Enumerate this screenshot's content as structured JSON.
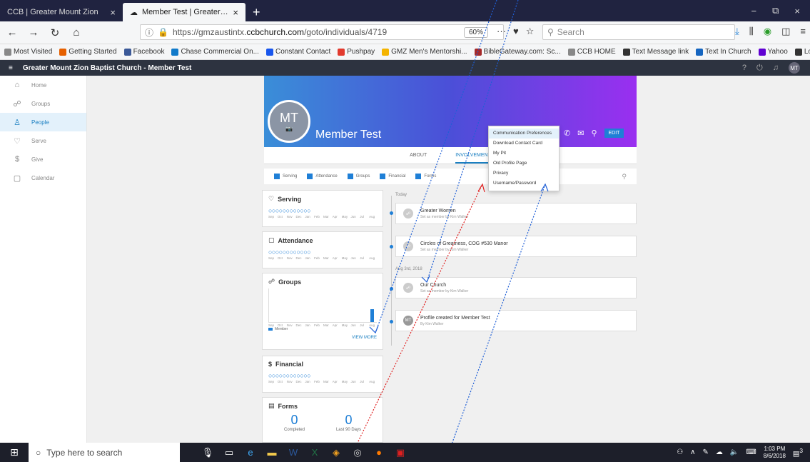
{
  "browser": {
    "tabs": [
      {
        "label": "CCB | Greater Mount Zion",
        "close": "×"
      },
      {
        "label": "Member Test | Greater Mount Z",
        "close": "×"
      }
    ],
    "new_tab": "+",
    "window_controls": [
      "−",
      "⧉",
      "×"
    ],
    "url_secure": "https://gmzaustintx.",
    "url_domain": "ccbchurch.com",
    "url_path": "/goto/individuals/4719",
    "zoom": "60%",
    "search_placeholder": "Search",
    "bookmarks": [
      {
        "label": "Most Visited",
        "color": "#888888"
      },
      {
        "label": "Getting Started",
        "color": "#e66000"
      },
      {
        "label": "Facebook",
        "color": "#3b5998"
      },
      {
        "label": "Chase Commercial On...",
        "color": "#117aca"
      },
      {
        "label": "Constant Contact",
        "color": "#1856ed"
      },
      {
        "label": "Pushpay",
        "color": "#e23b2e"
      },
      {
        "label": "GMZ Men's Mentorshi...",
        "color": "#f4b400"
      },
      {
        "label": "BibleGateway.com: Sc...",
        "color": "#a52a2a"
      },
      {
        "label": "CCB HOME",
        "color": "#888888"
      },
      {
        "label": "Text Message link",
        "color": "#333333"
      },
      {
        "label": "Text In Church",
        "color": "#1565c0"
      },
      {
        "label": "Yahoo",
        "color": "#6001d2"
      },
      {
        "label": "Login",
        "color": "#333333"
      }
    ]
  },
  "app": {
    "title": "Greater Mount Zion Baptist Church - Member Test",
    "avatar": "MT"
  },
  "sidebar": {
    "items": [
      {
        "label": "Home",
        "icon": "⌂"
      },
      {
        "label": "Groups",
        "icon": "☍"
      },
      {
        "label": "People",
        "icon": "♙"
      },
      {
        "label": "Serve",
        "icon": "♡"
      },
      {
        "label": "Give",
        "icon": "$"
      },
      {
        "label": "Calendar",
        "icon": "▢"
      }
    ]
  },
  "profile": {
    "initials": "MT",
    "name": "Member Test",
    "edit": "EDIT"
  },
  "tabs": [
    "ABOUT",
    "INVOLVEMENT"
  ],
  "filters": [
    "Serving",
    "Attendance",
    "Groups",
    "Financial",
    "Forms"
  ],
  "dropdown": [
    "Communication Preferences",
    "Download Contact Card",
    "My Pit",
    "Old Profile Page",
    "Privacy",
    "Username/Password"
  ],
  "cards": {
    "serving": "Serving",
    "attendance": "Attendance",
    "groups": "Groups",
    "groups_legend": "Member",
    "view_more": "VIEW MORE",
    "financial": "Financial",
    "forms": "Forms",
    "forms_completed_count": "0",
    "forms_completed_label": "Completed",
    "forms_last_count": "0",
    "forms_last_label": "Last 90 Days",
    "months": [
      "Sep",
      "Oct",
      "Nov",
      "Dec",
      "Jan",
      "Feb",
      "Mar",
      "Apr",
      "May",
      "Jun",
      "Jul",
      "Aug"
    ]
  },
  "timeline": {
    "today": "Today",
    "date2": "Aug 3rd, 2018",
    "items": [
      {
        "title": "Greater Women",
        "sub": "Set as member by Kim Walker"
      },
      {
        "title": "Circles of Greatness, COG #530 Manor",
        "sub": "Set as member by Kim Walker"
      },
      {
        "title": "Our Church",
        "sub": "Set as member by Kim Walker"
      },
      {
        "title": "Profile created for Member Test",
        "sub": "By Kim Walker"
      }
    ]
  },
  "taskbar": {
    "search_placeholder": "Type here to search",
    "time": "1:03 PM",
    "date": "8/6/2018",
    "notif_count": "3"
  }
}
